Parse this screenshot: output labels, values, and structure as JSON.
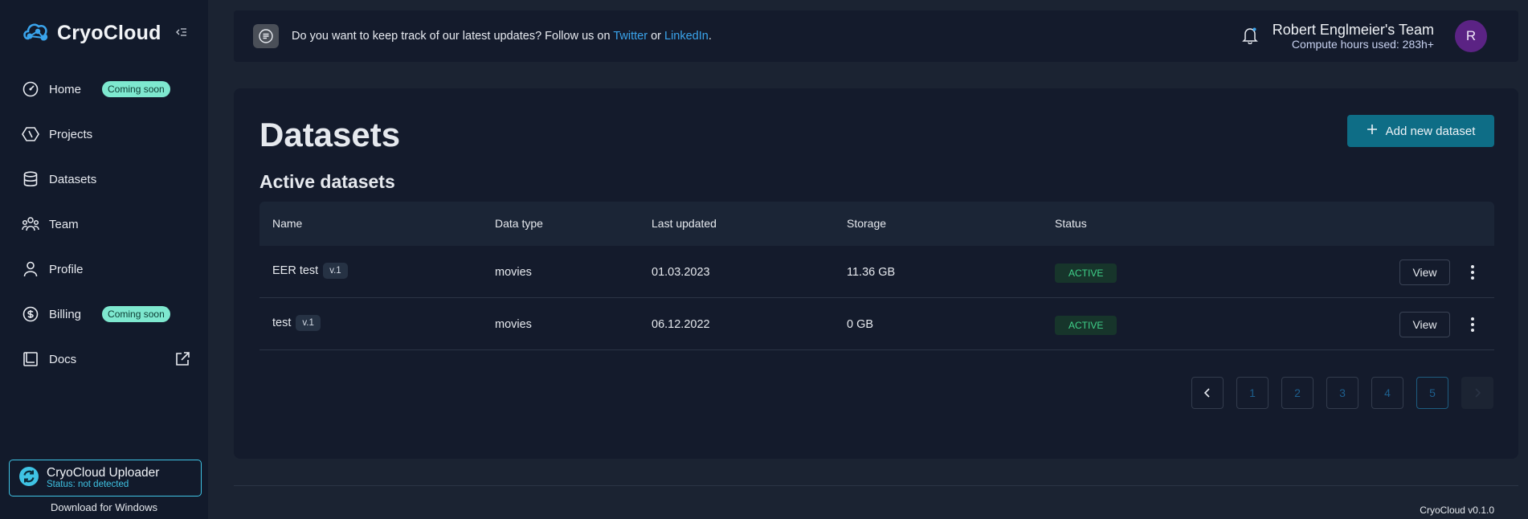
{
  "app": {
    "name": "CryoCloud"
  },
  "sidebar": {
    "items": [
      {
        "label": "Home",
        "badge": "Coming soon"
      },
      {
        "label": "Projects"
      },
      {
        "label": "Datasets"
      },
      {
        "label": "Team"
      },
      {
        "label": "Profile"
      },
      {
        "label": "Billing",
        "badge": "Coming soon"
      },
      {
        "label": "Docs"
      }
    ],
    "uploader": {
      "title": "CryoCloud Uploader",
      "status": "Status: not detected"
    },
    "download_label": "Download for Windows"
  },
  "topbar": {
    "message_prefix": "Do you want to keep track of our latest updates? Follow us on",
    "twitter": "Twitter",
    "or": "or",
    "linkedin": "LinkedIn",
    "period": ".",
    "team_name": "Robert Englmeier's Team",
    "compute_hours": "Compute hours used: 283h+",
    "avatar_initial": "R"
  },
  "main": {
    "title": "Datasets",
    "add_button": "Add new dataset",
    "section_title": "Active datasets",
    "columns": [
      "Name",
      "Data type",
      "Last updated",
      "Storage",
      "Status"
    ],
    "rows": [
      {
        "name": "EER test",
        "version": "v.1",
        "data_type": "movies",
        "last_updated": "01.03.2023",
        "storage": "11.36 GB",
        "status": "ACTIVE",
        "action": "View"
      },
      {
        "name": "test",
        "version": "v.1",
        "data_type": "movies",
        "last_updated": "06.12.2022",
        "storage": "0 GB",
        "status": "ACTIVE",
        "action": "View"
      }
    ],
    "pagination": {
      "pages": [
        "1",
        "2",
        "3",
        "4",
        "5"
      ],
      "current": "5"
    }
  },
  "footer": {
    "version": "CryoCloud v0.1.0"
  },
  "colors": {
    "accent": "#0e6d86",
    "badge": "#7ee8cf",
    "link": "#3aa4ec",
    "status_active": "#3fd18a"
  }
}
